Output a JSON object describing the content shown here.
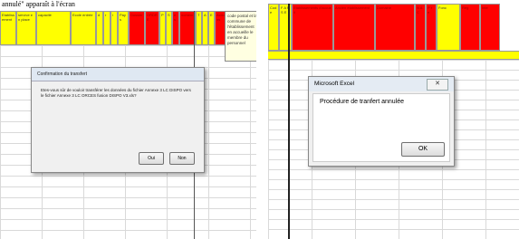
{
  "left": {
    "caption": "annulé\" apparaît à l'écran",
    "header_cells": [
      "Etablissement",
      "service en place",
      "capacité",
      "Ecole entrée",
      "d",
      "r",
      "i",
      "Pays",
      "Dossier",
      "ORDRE",
      "P",
      "S",
      "es",
      "nomem",
      "T",
      "A",
      "E",
      "Actions"
    ],
    "note_text": "code postal et la commune de l'établissement en accueille le membre du personnel",
    "dialog": {
      "title": "Confirmation du transfert",
      "message": "Etes-vous sûr de vouloir transférer les données du fichier Annexe 3 LC DISPO vers le fichier Annexe 3 LC ORCES fusion DISPO V3.xls?",
      "yes_label": "Oui",
      "no_label": "Non"
    }
  },
  "right": {
    "header_cells": [
      "Code",
      "F A R S E",
      "Etablissements d'accueil",
      "Ancien établissement",
      "Domaine",
      "N A C",
      "P r e",
      "Fonc",
      "Rég",
      "Inte"
    ],
    "dialog": {
      "title": "Microsoft Excel",
      "close_label": "✕",
      "message": "Procédure de tranfert annulée",
      "ok_label": "OK"
    }
  },
  "colors": {
    "header_yellow": "#ffff00",
    "header_red": "#ff0000"
  }
}
